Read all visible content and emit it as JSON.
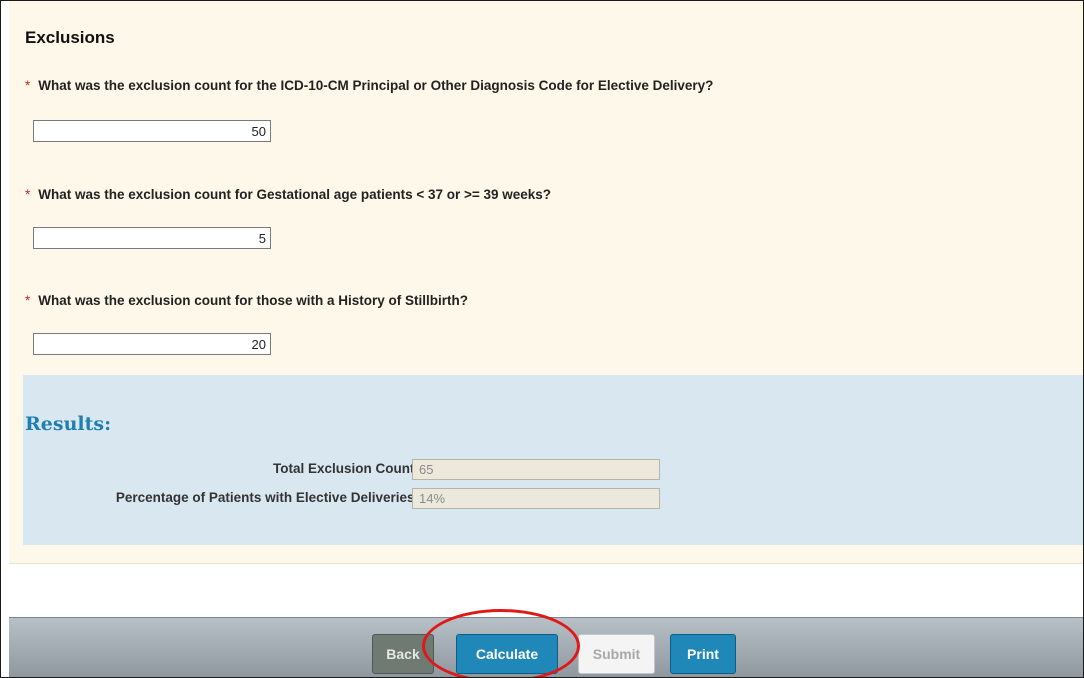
{
  "exclusions": {
    "title": "Exclusions",
    "required_marker": "*",
    "questions": [
      {
        "label": "What was the exclusion count for the ICD-10-CM Principal or Other Diagnosis Code for Elective Delivery?",
        "value": "50"
      },
      {
        "label": "What was the exclusion count for Gestational age patients < 37 or >= 39 weeks?",
        "value": "5"
      },
      {
        "label": "What was the exclusion count for those with a History of Stillbirth?",
        "value": "20"
      }
    ]
  },
  "results": {
    "title": "Results:",
    "total_label": "Total Exclusion Count:",
    "total_value": "65",
    "percentage_label": "Percentage of Patients with Elective Deliveries:",
    "percentage_value": "14%"
  },
  "footer": {
    "back_label": "Back",
    "calculate_label": "Calculate",
    "submit_label": "Submit",
    "print_label": "Print"
  },
  "colors": {
    "form_background": "#fdf8e9",
    "results_background": "#d9e8f0",
    "results_title": "#1f7fb0",
    "primary_button": "#1f88b8",
    "required_marker": "#cc2222",
    "annotation_highlight": "#e01818"
  }
}
